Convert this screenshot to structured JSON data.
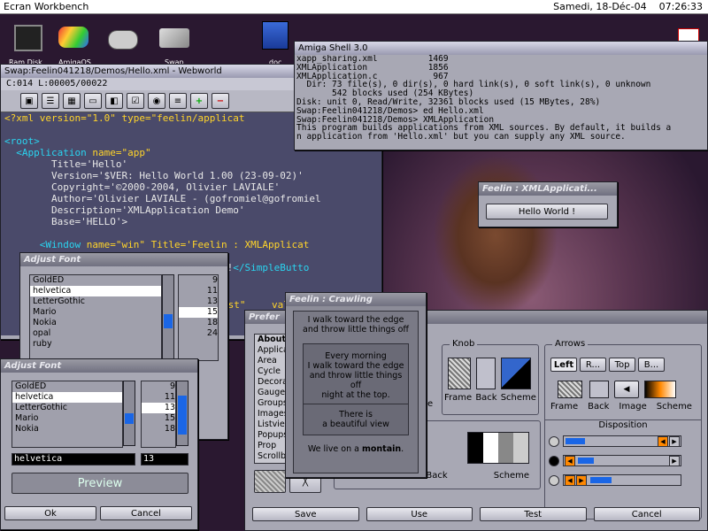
{
  "menubar": {
    "title": "Ecran Workbench",
    "date": "Samedi, 18-Déc-04",
    "time": "07:26:33"
  },
  "desktop_icons": [
    "Ram Disk",
    "AmigaOS",
    "",
    "",
    "Swap",
    "doc"
  ],
  "editor": {
    "title": "Swap:Feelin041218/Demos/Hello.xml - Webworld",
    "status": "C:014 L:00005/00022",
    "lines": [
      [
        [
          "attr",
          "<?xml version=\"1.0\" type=\"feelin/applicat"
        ]
      ],
      [
        [
          "txt",
          ""
        ]
      ],
      [
        [
          "tag",
          "<root>"
        ]
      ],
      [
        [
          "tag",
          "  <Application "
        ],
        [
          "attr",
          "name=\"app\""
        ]
      ],
      [
        [
          "txt",
          "        Title='Hello'"
        ]
      ],
      [
        [
          "txt",
          "        Version='$VER: Hello World 1.00 (23-09-02)'"
        ]
      ],
      [
        [
          "txt",
          "        Copyright='©2000-2004, Olivier LAVIALE'"
        ]
      ],
      [
        [
          "txt",
          "        Author='Olivier LAVIALE - (gofromiel@gofromiel"
        ]
      ],
      [
        [
          "txt",
          "        Description='XMLApplication Demo'"
        ]
      ],
      [
        [
          "txt",
          "        Base='HELLO'>"
        ]
      ],
      [
        [
          "txt",
          ""
        ]
      ],
      [
        [
          "tag",
          "      <Window "
        ],
        [
          "attr",
          "name=\"win\" Title='Feelin : XMLApplicat"
        ]
      ],
      [
        [
          "tag",
          "         <Group>"
        ]
      ],
      [
        [
          "tag",
          "            <SimpleButton>"
        ],
        [
          "txt",
          "Hello World !"
        ],
        [
          "tag",
          "</SimpleButto"
        ]
      ]
    ],
    "fragment1": "est\"",
    "fragment2": "val"
  },
  "shell": {
    "title": "Amiga Shell 3.0",
    "lines": [
      "xapp_sharing.xml          1469",
      "XMLApplication            1856",
      "XMLApplication.c           967",
      "",
      "  Dir: 73 file(s), 0 dir(s), 0 hard link(s), 0 soft link(s), 0 unknown",
      "       542 blocks used (254 KBytes)",
      "Disk: unit 0, Read/Write, 32361 blocks used (15 MBytes, 28%)",
      "",
      "Swap:Feelin041218/Demos> ed Hello.xml",
      "Swap:Feelin041218/Demos> XMLApplication",
      "This program builds applications from XML sources. By default, it builds a",
      "n application from 'Hello.xml' but you can supply any XML source."
    ]
  },
  "hello": {
    "title": "Feelin : XMLApplicati...",
    "button": "Hello World !"
  },
  "font1": {
    "title": "Adjust Font",
    "fonts": [
      "GoldED",
      "helvetica",
      "LetterGothic",
      "Mario",
      "Nokia",
      "opal",
      "ruby"
    ],
    "selected": 1,
    "sizes": [
      "9",
      "11",
      "13",
      "15",
      "18",
      "24"
    ],
    "size_selected": 3
  },
  "font2": {
    "title": "Adjust Font",
    "fonts": [
      "GoldED",
      "helvetica",
      "LetterGothic",
      "Mario",
      "Nokia"
    ],
    "selected": 1,
    "sizes": [
      "9",
      "11",
      "13",
      "15",
      "18"
    ],
    "size_selected": 2,
    "font_value": "helvetica",
    "size_value": "13",
    "preview": "Preview",
    "ok": "Ok",
    "cancel": "Cancel"
  },
  "crawling": {
    "title": "Feelin : Crawling",
    "top": [
      "I walk toward the edge",
      "and throw little things off"
    ],
    "mid": [
      "Every morning",
      "I walk toward the edge",
      "and throw little things off",
      "night at the top."
    ],
    "low": [
      "There is",
      "a beautiful view"
    ],
    "bottom_a": "We live on a ",
    "bottom_b": "montain",
    "bottom_c": "."
  },
  "prefs": {
    "title": "Prefer",
    "categories": [
      "About",
      "Applica",
      "Area",
      "Cycle",
      "Decora",
      "Gauge",
      "Groups",
      "Images",
      "Listvie",
      "Popups",
      "Prop",
      "Scrollb"
    ],
    "knob_label": "Knob",
    "arrows_label": "Arrows",
    "disposition_label": "Disposition",
    "knob_buttons": [
      "Frame",
      "Back",
      "Scheme"
    ],
    "tabs": [
      "Left",
      "R...",
      "Top",
      "B..."
    ],
    "arrow_buttons": [
      "Frame",
      "Back",
      "Image",
      "Scheme"
    ],
    "lower_labels": [
      "Frame",
      "Back",
      "Scheme"
    ],
    "side_label": "e",
    "actions": [
      "Save",
      "Use",
      "Test",
      "Cancel"
    ]
  }
}
